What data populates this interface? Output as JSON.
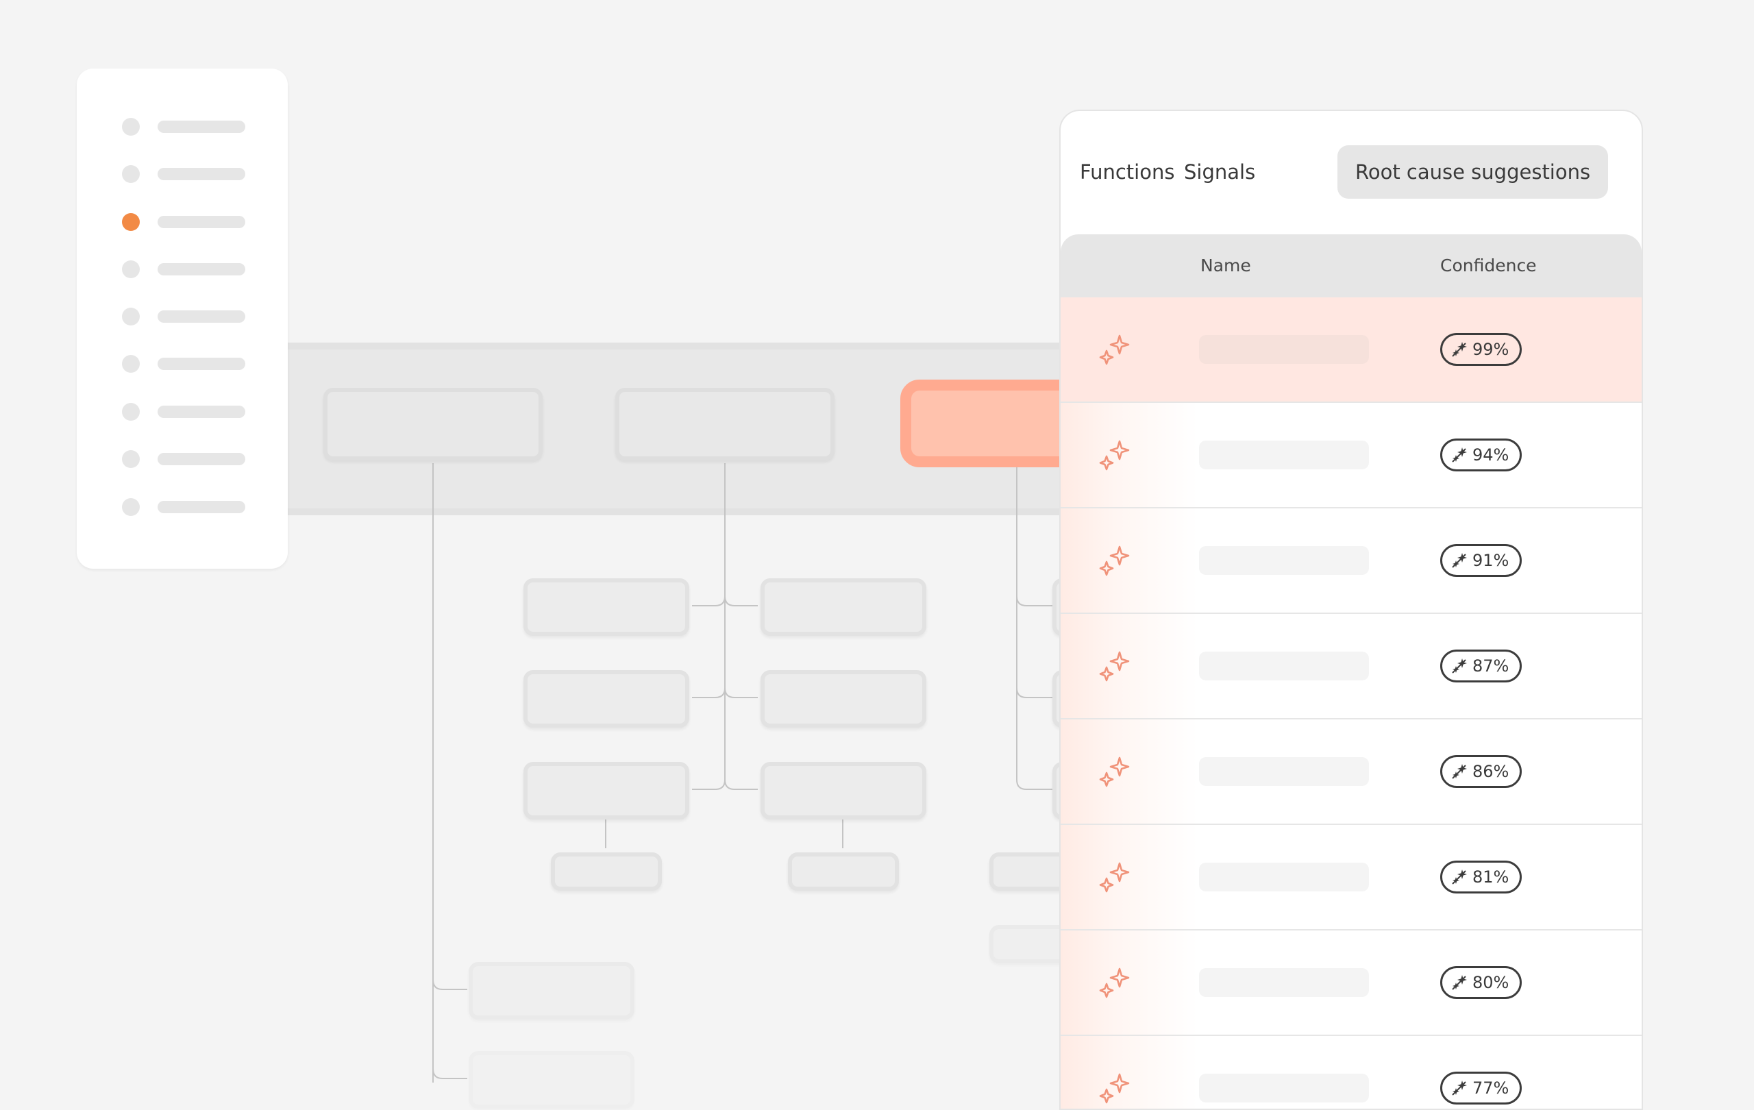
{
  "colors": {
    "accent": "#f28a45",
    "highlight_fill": "#ffc2ad",
    "highlight_border": "#ffaa90",
    "row_highlight": "#ffe7e1",
    "sparkle": "#f0937a"
  },
  "sidebar": {
    "active_index": 2,
    "items": [
      {
        "icon": "dot"
      },
      {
        "icon": "dot"
      },
      {
        "icon": "dot"
      },
      {
        "icon": "dot"
      },
      {
        "icon": "dot"
      },
      {
        "icon": "dot"
      },
      {
        "icon": "dot"
      },
      {
        "icon": "dot"
      },
      {
        "icon": "dot"
      }
    ]
  },
  "panel": {
    "tabs": [
      {
        "label": "Functions",
        "active": false
      },
      {
        "label": "Signals",
        "active": false
      },
      {
        "label": "Root cause suggestions",
        "active": true
      }
    ],
    "columns": {
      "name": "Name",
      "confidence": "Confidence"
    },
    "rows": [
      {
        "icon": "sparkle-icon",
        "confidence": "99%",
        "highlighted": true
      },
      {
        "icon": "sparkle-icon",
        "confidence": "94%",
        "highlighted": false
      },
      {
        "icon": "sparkle-icon",
        "confidence": "91%",
        "highlighted": false
      },
      {
        "icon": "sparkle-icon",
        "confidence": "87%",
        "highlighted": false
      },
      {
        "icon": "sparkle-icon",
        "confidence": "86%",
        "highlighted": false
      },
      {
        "icon": "sparkle-icon",
        "confidence": "81%",
        "highlighted": false
      },
      {
        "icon": "sparkle-icon",
        "confidence": "80%",
        "highlighted": false
      },
      {
        "icon": "sparkle-icon",
        "confidence": "77%",
        "highlighted": false
      }
    ]
  }
}
